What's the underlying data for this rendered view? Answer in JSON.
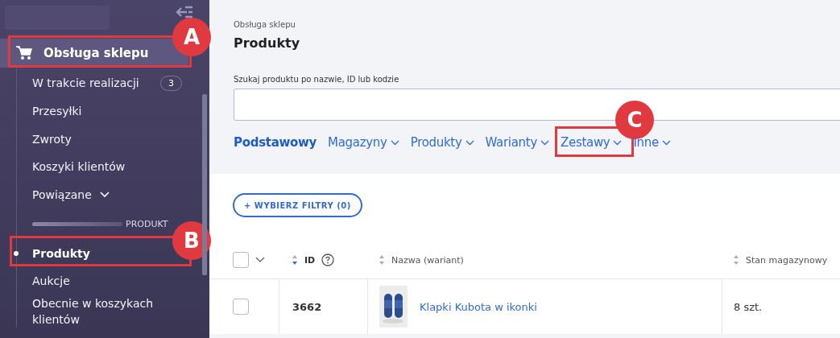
{
  "sidebar": {
    "section": {
      "label": "Obsługa sklepu",
      "selected": true,
      "callout": "A"
    },
    "items": [
      {
        "kind": "link",
        "label": "W trakcie realizacji",
        "badge": "3",
        "selected": false
      },
      {
        "kind": "link",
        "label": "Przesyłki",
        "selected": false
      },
      {
        "kind": "link",
        "label": "Zwroty",
        "selected": false
      },
      {
        "kind": "link",
        "label": "Koszyki klientów",
        "selected": false
      },
      {
        "kind": "expander",
        "label": "Powiązane",
        "selected": false
      },
      {
        "kind": "divider",
        "label": "PRODUKT"
      },
      {
        "kind": "link",
        "label": "Produkty",
        "selected": true,
        "callout": "B"
      },
      {
        "kind": "link",
        "label": "Aukcje",
        "selected": false
      },
      {
        "kind": "link",
        "label": "Obecnie w koszykach klientów",
        "selected": false
      }
    ]
  },
  "breadcrumb": "Obsługa sklepu",
  "title": "Produkty",
  "search": {
    "label": "Szukaj produktu po nazwie, ID lub kodzie"
  },
  "tabs": [
    {
      "label": "Podstawowy",
      "selected": true,
      "dropdown": false
    },
    {
      "label": "Magazyny",
      "selected": false,
      "dropdown": true
    },
    {
      "label": "Produkty",
      "selected": false,
      "dropdown": true
    },
    {
      "label": "Warianty",
      "selected": false,
      "dropdown": true
    },
    {
      "label": "Zestawy",
      "selected": false,
      "dropdown": true,
      "callout": "C"
    },
    {
      "label": "Inne",
      "selected": false,
      "dropdown": true
    }
  ],
  "filter_button": "+ WYBIERZ FILTRY (0)",
  "table": {
    "columns": [
      {
        "kind": "select",
        "checked": false
      },
      {
        "kind": "id",
        "label": "ID",
        "sort_active": true
      },
      {
        "kind": "name",
        "label": "Nazwa (wariant)",
        "sort_active": false
      },
      {
        "kind": "stock",
        "label": "Stan magazynowy",
        "sort_active": false
      }
    ],
    "rows": [
      {
        "checked": false,
        "id": "3662",
        "name": "Klapki Kubota w ikonki",
        "stock": "8 szt."
      }
    ]
  }
}
